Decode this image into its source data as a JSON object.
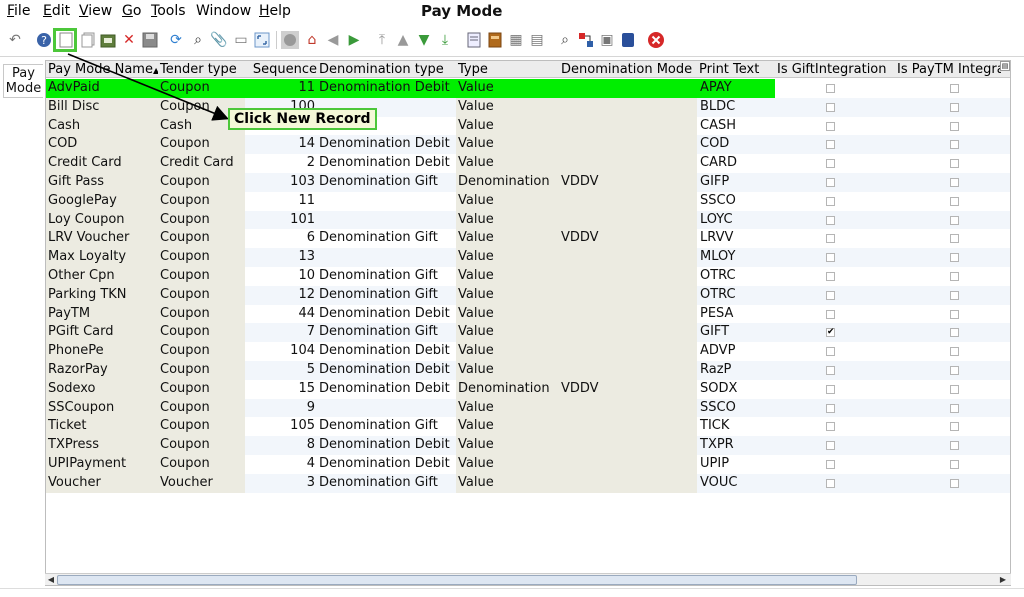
{
  "window": {
    "title": "Pay Mode"
  },
  "menu": {
    "items": [
      {
        "label": "File",
        "acc": "F",
        "rest": "ile"
      },
      {
        "label": "Edit",
        "acc": "E",
        "rest": "dit"
      },
      {
        "label": "View",
        "acc": "V",
        "rest": "iew"
      },
      {
        "label": "Go",
        "acc": "G",
        "rest": "o"
      },
      {
        "label": "Tools",
        "acc": "T",
        "rest": "ools"
      },
      {
        "label": "Window",
        "acc": "",
        "rest": "Window"
      },
      {
        "label": "Help",
        "acc": "H",
        "rest": "elp"
      }
    ]
  },
  "side_tab": {
    "line1": "Pay",
    "line2": "Mode"
  },
  "annotation": {
    "callout": "Click New Record",
    "color": "#4cc73a"
  },
  "grid": {
    "columns": [
      "Pay Mode Name",
      "Tender type",
      "Sequence",
      "Denomination type",
      "Type",
      "Denomination Mode",
      "Print Text",
      "Is GiftIntegration",
      "Is PayTM Integration"
    ],
    "sort_column": "Pay Mode Name",
    "sort_indicator": "▲",
    "selected_row_color": "#00ee00",
    "rows": [
      {
        "name": "AdvPaid",
        "tender": "Coupon",
        "seq": "11",
        "dtype": "Denomination Debit",
        "type": "Value",
        "dmode": "",
        "print": "APAY",
        "gift": false,
        "paytm": false
      },
      {
        "name": "Bill Disc",
        "tender": "Coupon",
        "seq": "100",
        "dtype": "",
        "type": "Value",
        "dmode": "",
        "print": "BLDC",
        "gift": false,
        "paytm": false
      },
      {
        "name": "Cash",
        "tender": "Cash",
        "seq": "",
        "dtype": "",
        "type": "Value",
        "dmode": "",
        "print": "CASH",
        "gift": false,
        "paytm": false
      },
      {
        "name": "COD",
        "tender": "Coupon",
        "seq": "14",
        "dtype": "Denomination Debit",
        "type": "Value",
        "dmode": "",
        "print": "COD",
        "gift": false,
        "paytm": false
      },
      {
        "name": "Credit Card",
        "tender": "Credit Card",
        "seq": "2",
        "dtype": "Denomination Debit",
        "type": "Value",
        "dmode": "",
        "print": "CARD",
        "gift": false,
        "paytm": false
      },
      {
        "name": "Gift Pass",
        "tender": "Coupon",
        "seq": "103",
        "dtype": "Denomination Gift",
        "type": "Denomination",
        "dmode": "VDDV",
        "print": "GIFP",
        "gift": false,
        "paytm": false
      },
      {
        "name": "GooglePay",
        "tender": "Coupon",
        "seq": "11",
        "dtype": "",
        "type": "Value",
        "dmode": "",
        "print": "SSCO",
        "gift": false,
        "paytm": false
      },
      {
        "name": "Loy Coupon",
        "tender": "Coupon",
        "seq": "101",
        "dtype": "",
        "type": "Value",
        "dmode": "",
        "print": "LOYC",
        "gift": false,
        "paytm": false
      },
      {
        "name": "LRV Voucher",
        "tender": "Coupon",
        "seq": "6",
        "dtype": "Denomination Gift",
        "type": "Value",
        "dmode": "VDDV",
        "print": "LRVV",
        "gift": false,
        "paytm": false
      },
      {
        "name": "Max Loyalty",
        "tender": "Coupon",
        "seq": "13",
        "dtype": "",
        "type": "Value",
        "dmode": "",
        "print": "MLOY",
        "gift": false,
        "paytm": false
      },
      {
        "name": "Other Cpn",
        "tender": "Coupon",
        "seq": "10",
        "dtype": "Denomination Gift",
        "type": "Value",
        "dmode": "",
        "print": "OTRC",
        "gift": false,
        "paytm": false
      },
      {
        "name": "Parking TKN",
        "tender": "Coupon",
        "seq": "12",
        "dtype": "Denomination Gift",
        "type": "Value",
        "dmode": "",
        "print": "OTRC",
        "gift": false,
        "paytm": false
      },
      {
        "name": "PayTM",
        "tender": "Coupon",
        "seq": "44",
        "dtype": "Denomination Debit",
        "type": "Value",
        "dmode": "",
        "print": "PESA",
        "gift": false,
        "paytm": false
      },
      {
        "name": "PGift Card",
        "tender": "Coupon",
        "seq": "7",
        "dtype": "Denomination Gift",
        "type": "Value",
        "dmode": "",
        "print": "GIFT",
        "gift": true,
        "paytm": false
      },
      {
        "name": "PhonePe",
        "tender": "Coupon",
        "seq": "104",
        "dtype": "Denomination Debit",
        "type": "Value",
        "dmode": "",
        "print": "ADVP",
        "gift": false,
        "paytm": false
      },
      {
        "name": "RazorPay",
        "tender": "Coupon",
        "seq": "5",
        "dtype": "Denomination Debit",
        "type": "Value",
        "dmode": "",
        "print": "RazP",
        "gift": false,
        "paytm": false
      },
      {
        "name": "Sodexo",
        "tender": "Coupon",
        "seq": "15",
        "dtype": "Denomination Debit",
        "type": "Denomination",
        "dmode": "VDDV",
        "print": "SODX",
        "gift": false,
        "paytm": false
      },
      {
        "name": "SSCoupon",
        "tender": "Coupon",
        "seq": "9",
        "dtype": "",
        "type": "Value",
        "dmode": "",
        "print": "SSCO",
        "gift": false,
        "paytm": false
      },
      {
        "name": "Ticket",
        "tender": "Coupon",
        "seq": "105",
        "dtype": "Denomination Gift",
        "type": "Value",
        "dmode": "",
        "print": "TICK",
        "gift": false,
        "paytm": false
      },
      {
        "name": "TXPress",
        "tender": "Coupon",
        "seq": "8",
        "dtype": "Denomination Debit",
        "type": "Value",
        "dmode": "",
        "print": "TXPR",
        "gift": false,
        "paytm": false
      },
      {
        "name": "UPIPayment",
        "tender": "Coupon",
        "seq": "4",
        "dtype": "Denomination Debit",
        "type": "Value",
        "dmode": "",
        "print": "UPIP",
        "gift": false,
        "paytm": false
      },
      {
        "name": "Voucher",
        "tender": "Voucher",
        "seq": "3",
        "dtype": "Denomination Gift",
        "type": "Value",
        "dmode": "",
        "print": "VOUC",
        "gift": false,
        "paytm": false
      }
    ]
  }
}
